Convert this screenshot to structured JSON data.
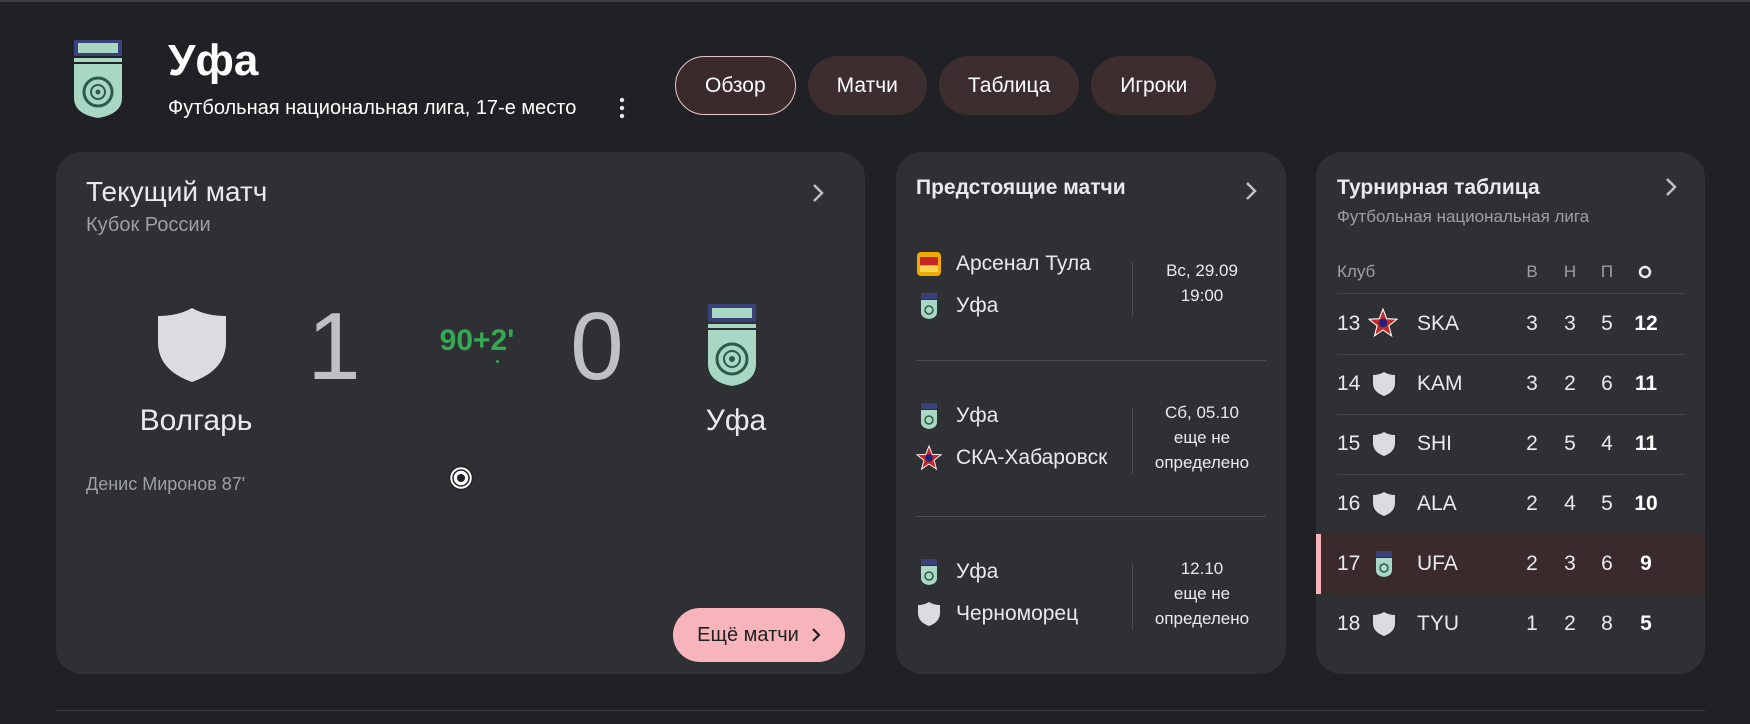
{
  "header": {
    "team_name": "Уфа",
    "subtitle": "Футбольная национальная лига, 17-е место"
  },
  "tabs": [
    {
      "label": "Обзор",
      "active": true
    },
    {
      "label": "Матчи",
      "active": false
    },
    {
      "label": "Таблица",
      "active": false
    },
    {
      "label": "Игроки",
      "active": false
    }
  ],
  "current_match": {
    "title": "Текущий матч",
    "competition": "Кубок России",
    "home": {
      "name": "Волгарь",
      "score": "1"
    },
    "away": {
      "name": "Уфа",
      "score": "0"
    },
    "minute": "90+2'",
    "scorer": "Денис Миронов 87'",
    "more_button": "Ещё матчи"
  },
  "upcoming": {
    "title": "Предстоящие матчи",
    "fixtures": [
      {
        "team1": "Арсенал Тула",
        "team2": "Уфа",
        "date_line1": "Вс, 29.09",
        "date_line2": "19:00",
        "date_line3": ""
      },
      {
        "team1": "Уфа",
        "team2": "СКА-Хабаровск",
        "date_line1": "Сб, 05.10",
        "date_line2": "еще не",
        "date_line3": "определено"
      },
      {
        "team1": "Уфа",
        "team2": "Черноморец",
        "date_line1": "12.10",
        "date_line2": "еще не",
        "date_line3": "определено"
      }
    ]
  },
  "standings": {
    "title": "Турнирная таблица",
    "subtitle": "Футбольная национальная лига",
    "headers": {
      "club": "Клуб",
      "w": "В",
      "d": "Н",
      "l": "П"
    },
    "rows": [
      {
        "pos": "13",
        "team": "SKA",
        "w": "3",
        "d": "3",
        "l": "5",
        "pts": "12",
        "highlight": false
      },
      {
        "pos": "14",
        "team": "KAM",
        "w": "3",
        "d": "2",
        "l": "6",
        "pts": "11",
        "highlight": false
      },
      {
        "pos": "15",
        "team": "SHI",
        "w": "2",
        "d": "5",
        "l": "4",
        "pts": "11",
        "highlight": false
      },
      {
        "pos": "16",
        "team": "ALA",
        "w": "2",
        "d": "4",
        "l": "5",
        "pts": "10",
        "highlight": false
      },
      {
        "pos": "17",
        "team": "UFA",
        "w": "2",
        "d": "3",
        "l": "6",
        "pts": "9",
        "highlight": true
      },
      {
        "pos": "18",
        "team": "TYU",
        "w": "1",
        "d": "2",
        "l": "8",
        "pts": "5",
        "highlight": false
      }
    ]
  },
  "colors": {
    "accent_pink": "#f8b4bb",
    "live_green": "#34a853",
    "crest_green": "#a8d8c4"
  }
}
